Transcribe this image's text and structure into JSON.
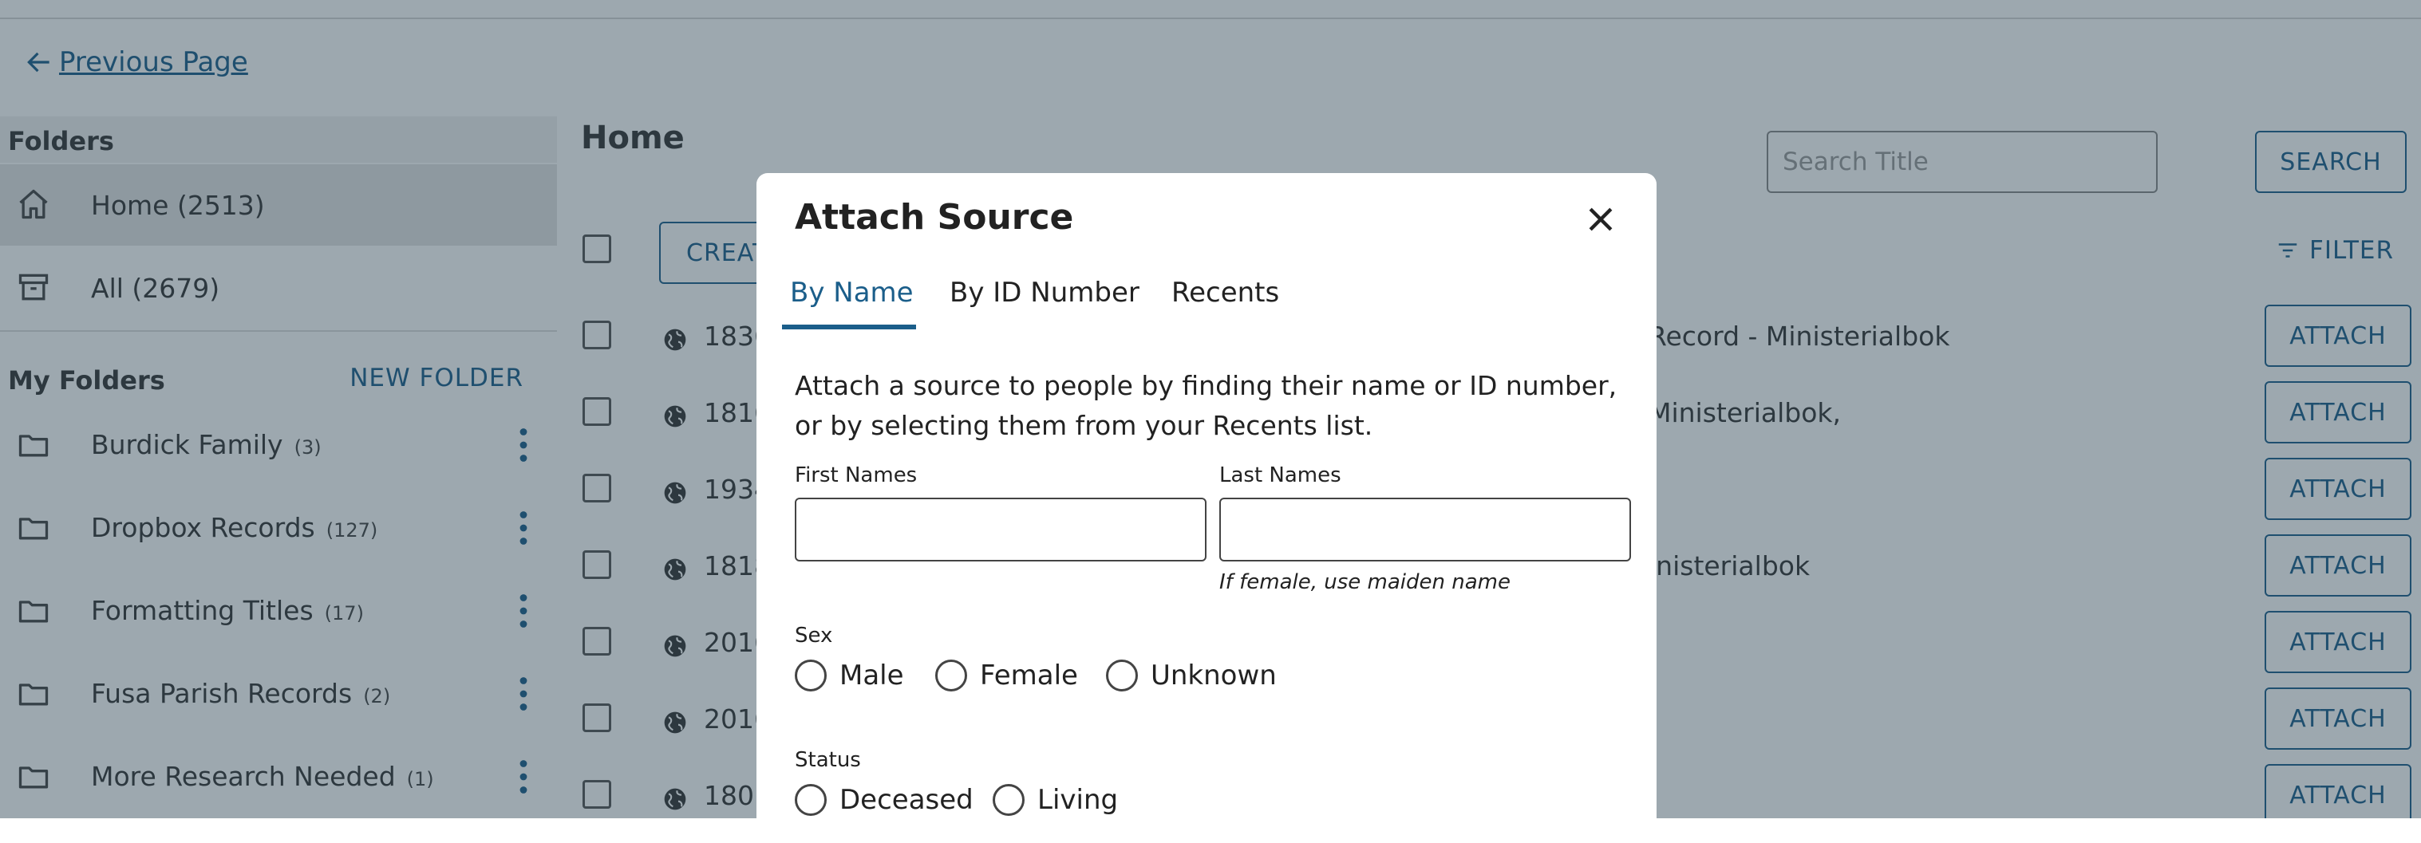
{
  "back_link": {
    "label": "Previous Page"
  },
  "sidebar": {
    "heading": "Folders",
    "home": {
      "label": "Home (2513)"
    },
    "all": {
      "label": "All (2679)"
    },
    "my_folders_heading": "My Folders",
    "new_folder_label": "NEW FOLDER",
    "folders": [
      {
        "name": "Burdick Family",
        "count": "(3)"
      },
      {
        "name": "Dropbox Records",
        "count": "(127)"
      },
      {
        "name": "Formatting Titles",
        "count": "(17)"
      },
      {
        "name": "Fusa Parish Records",
        "count": "(2)"
      },
      {
        "name": "More Research Needed",
        "count": "(1)"
      }
    ]
  },
  "main": {
    "title": "Home",
    "search_placeholder": "Search Title",
    "search_button": "SEARCH",
    "create_button": "CREATE",
    "filter_label": "FILTER",
    "rows": [
      {
        "date": "1836",
        "title_tail": "Record - Ministerialbok",
        "action": "ATTACH"
      },
      {
        "date": "1816",
        "title_tail": "Ministerialbok,",
        "action": "ATTACH"
      },
      {
        "date": "1934",
        "title_tail": "",
        "action": "ATTACH"
      },
      {
        "date": "1818",
        "title_tail": "inisterialbok",
        "action": "ATTACH"
      },
      {
        "date": "2016",
        "title_tail": "",
        "action": "ATTACH"
      },
      {
        "date": "2016",
        "title_tail": "",
        "action": "ATTACH"
      },
      {
        "date": "1801",
        "title_tail": "",
        "action": "ATTACH"
      }
    ]
  },
  "modal": {
    "title": "Attach Source",
    "tabs": [
      "By Name",
      "By ID Number",
      "Recents"
    ],
    "active_tab": "By Name",
    "description": "Attach a source to people by finding their name or ID number, or by selecting them from your Recents list.",
    "first_names_label": "First Names",
    "first_names_value": "",
    "last_names_label": "Last Names",
    "last_names_value": "",
    "last_names_hint": "If female, use maiden name",
    "sex_label": "Sex",
    "sex_options": [
      "Male",
      "Female",
      "Unknown"
    ],
    "status_label": "Status",
    "status_options": [
      "Deceased",
      "Living"
    ]
  },
  "colors": {
    "accent": "#1b5e8a",
    "overlay": "#263e4e"
  },
  "icons": [
    "arrow-left-icon",
    "home-icon",
    "archive-box-icon",
    "folder-icon",
    "kebab-icon",
    "globe-icon",
    "filter-icon",
    "close-icon"
  ]
}
